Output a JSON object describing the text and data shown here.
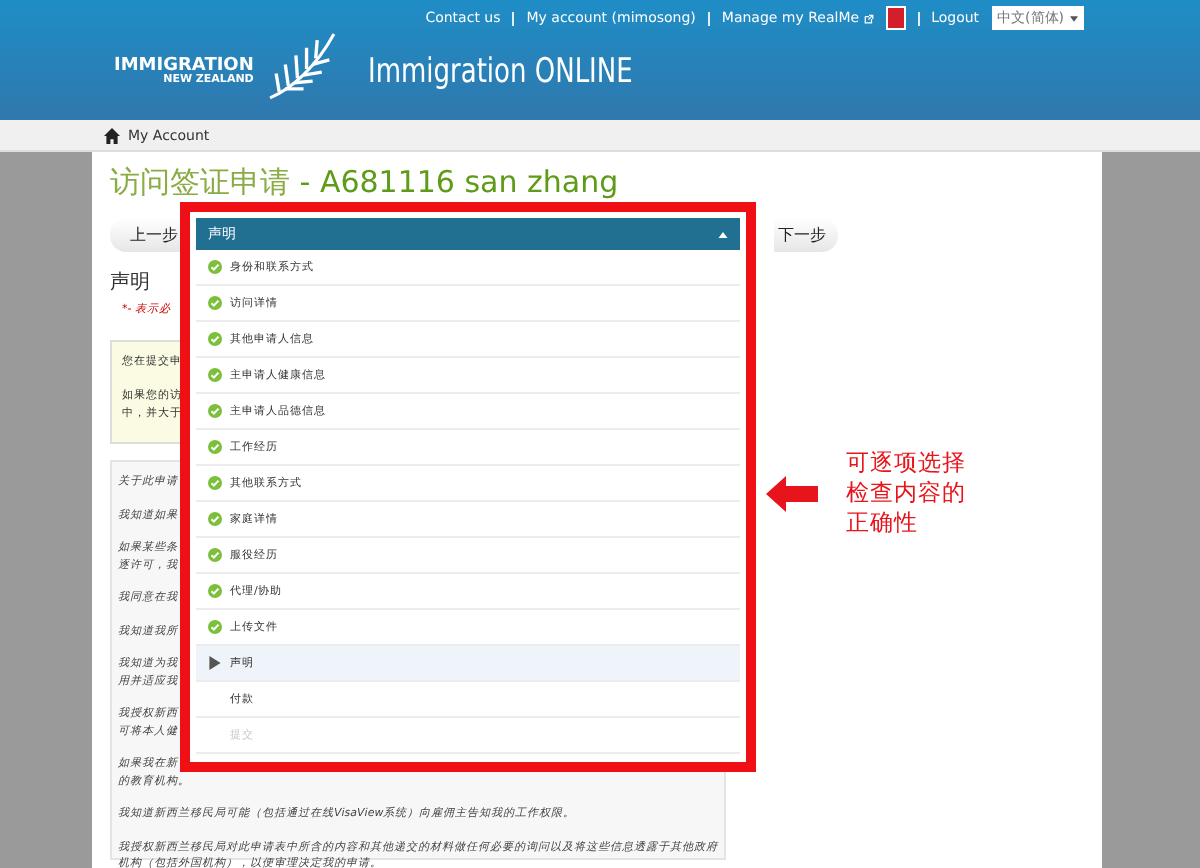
{
  "header": {
    "links": [
      "Contact us",
      "My account (mimosong)",
      "Manage my RealMe",
      "Logout"
    ],
    "language": "中文(简体)",
    "logo_line1": "IMMIGRATION",
    "logo_line2": "NEW ZEALAND",
    "site_title": "Immigration ONLINE"
  },
  "breadcrumb": "My Account",
  "page": {
    "title_prefix": "访问签证申请",
    "title_suffix": " - A681116 san zhang",
    "prev_button": "上一步",
    "next_button": "下一步",
    "section_heading": "声明",
    "required_note": "*- 表示必",
    "info_lines": [
      "您在提交申",
      "如果您的访",
      "中，并大于"
    ],
    "declaration_fragments": [
      "关于此申请",
      "我知道如果",
      "如果某些条",
      "逐许可，我",
      "我同意在我",
      "我知道我所",
      "我知道为我",
      "用并适应我",
      "我授权新西",
      "可将本人健",
      "如果我在新"
    ],
    "declaration_lines": [
      "的教育机构。",
      "我知道新西兰移民局可能（包括通过在线VisaView系统）向雇佣主告知我的工作权限。",
      "我授权新西兰移民局对此申请表中所含的内容和其他递交的材料做任何必要的询问以及将这些信息透露于其他政府机构（包括外国机构），以便审理决定我的申请。"
    ]
  },
  "dropdown": {
    "title": "声明",
    "items": [
      {
        "label": "身份和联系方式",
        "kind": "complete",
        "selected": false
      },
      {
        "label": "访问详情",
        "kind": "complete",
        "selected": false
      },
      {
        "label": "其他申请人信息",
        "kind": "complete",
        "selected": false
      },
      {
        "label": "主申请人健康信息",
        "kind": "complete",
        "selected": false
      },
      {
        "label": "主申请人品德信息",
        "kind": "complete",
        "selected": false
      },
      {
        "label": "工作经历",
        "kind": "complete",
        "selected": false
      },
      {
        "label": "其他联系方式",
        "kind": "complete",
        "selected": false
      },
      {
        "label": "家庭详情",
        "kind": "complete",
        "selected": false
      },
      {
        "label": "服役经历",
        "kind": "complete",
        "selected": false
      },
      {
        "label": "代理/协助",
        "kind": "complete",
        "selected": false
      },
      {
        "label": "上传文件",
        "kind": "complete",
        "selected": false
      },
      {
        "label": "声明",
        "kind": "current",
        "selected": true
      },
      {
        "label": "付款",
        "kind": "pending",
        "selected": false
      },
      {
        "label": "提交",
        "kind": "disabled",
        "selected": false
      }
    ]
  },
  "annotation": "可逐项选择检查内容的正确性"
}
